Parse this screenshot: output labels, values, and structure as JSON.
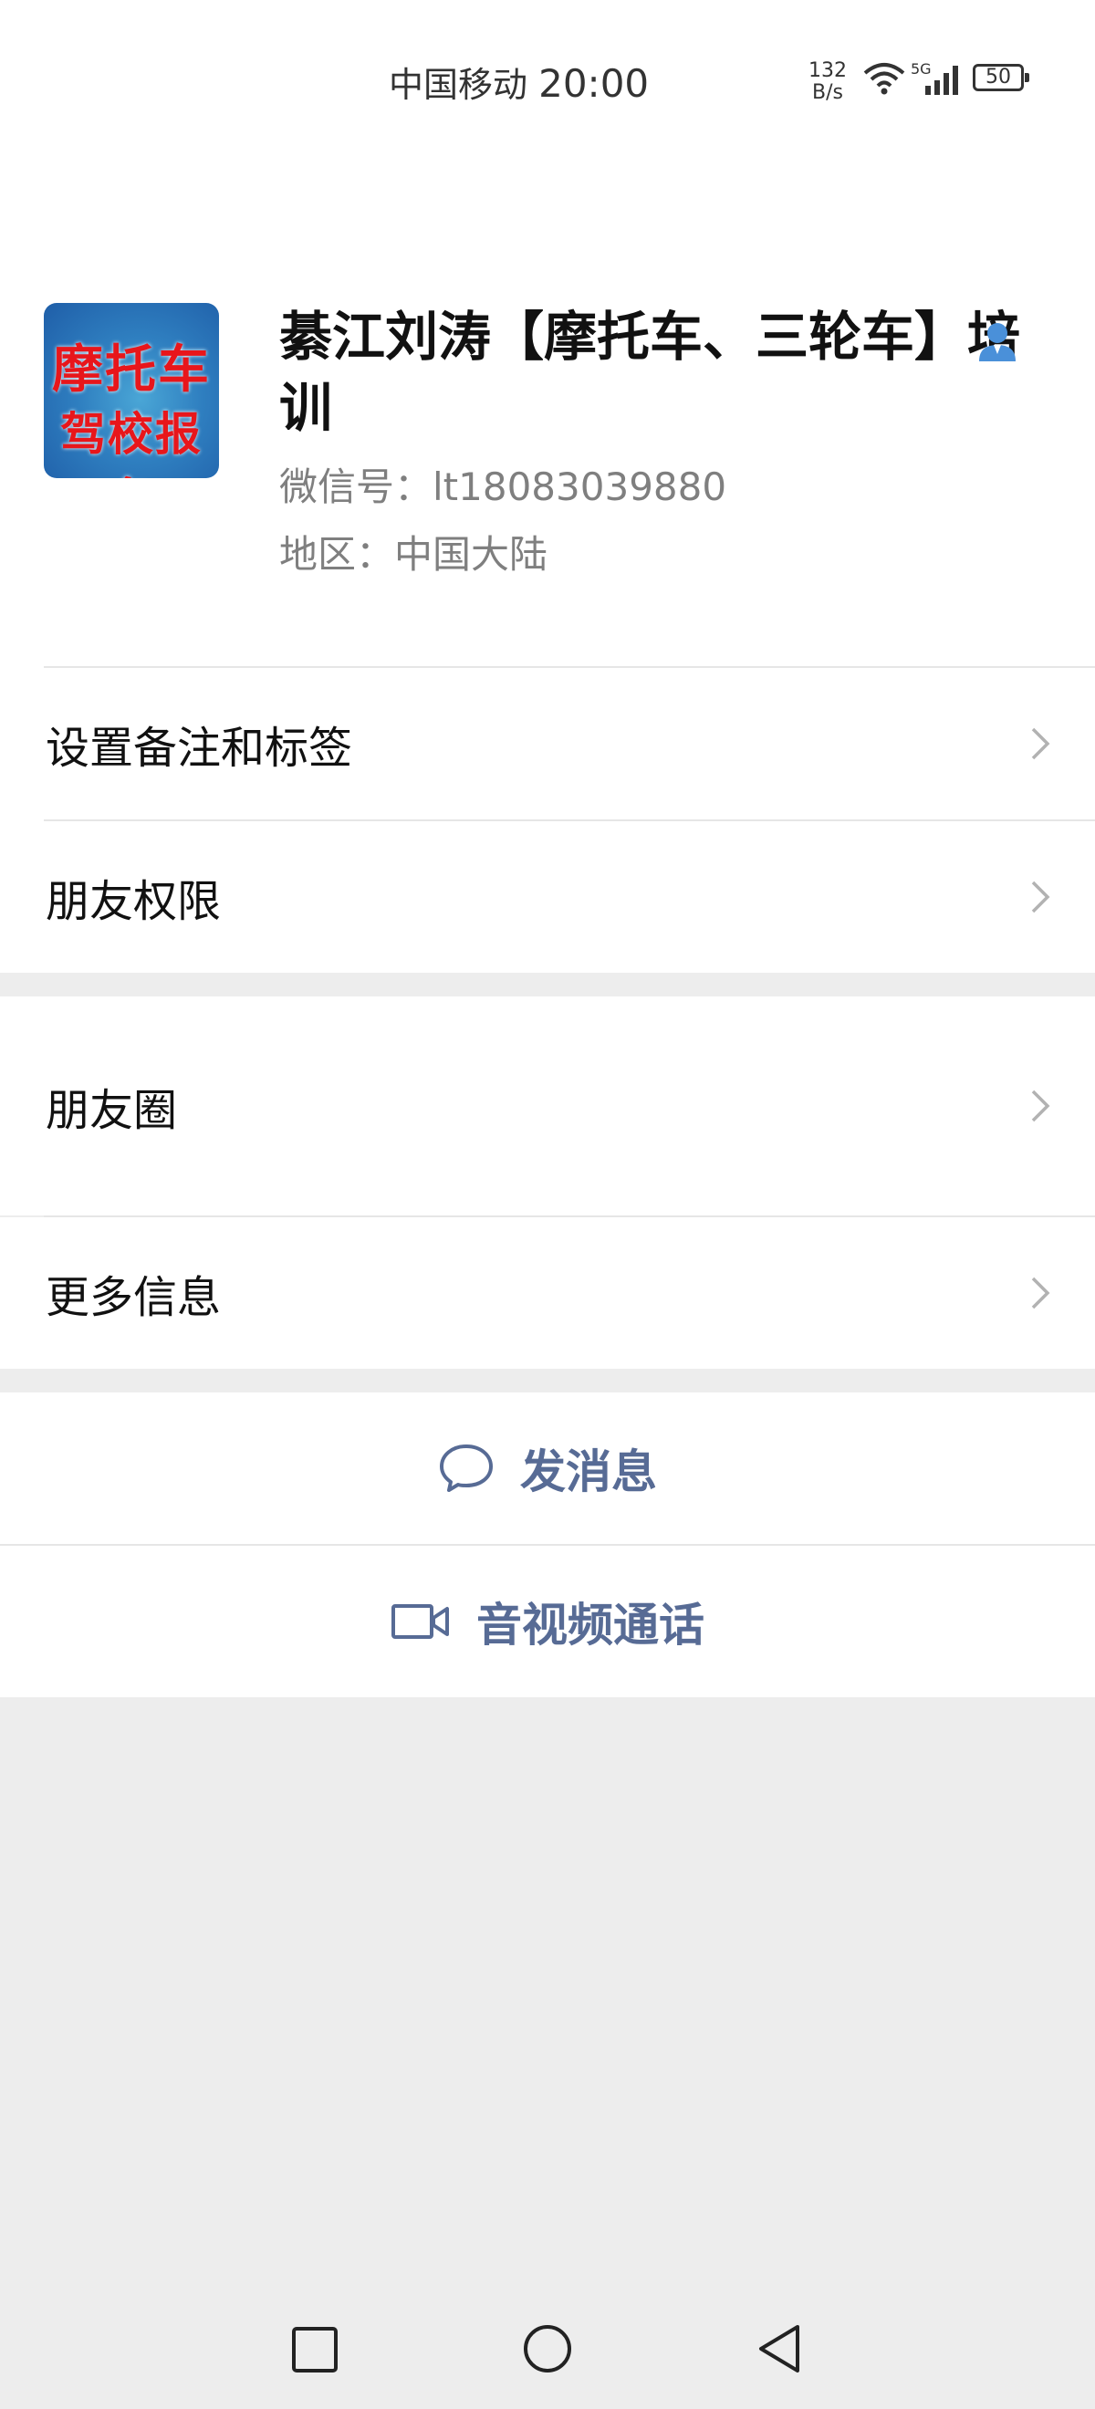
{
  "status_bar": {
    "carrier": "中国移动",
    "time": "20:00",
    "net_speed_value": "132",
    "net_speed_unit": "B/s",
    "network": "5G",
    "battery": "50"
  },
  "profile": {
    "name": "綦江刘涛【摩托车、三轮车】培训",
    "avatar_line1": "摩托车",
    "avatar_line2": "驾校报名",
    "wechat_id": "微信号：lt18083039880",
    "region": "地区：中国大陆"
  },
  "menu": {
    "remark_tags": "设置备注和标签",
    "friend_permissions": "朋友权限",
    "moments": "朋友圈",
    "more_info": "更多信息"
  },
  "actions": {
    "send_message": "发消息",
    "av_call": "音视频通话"
  },
  "colors": {
    "link": "#576b95",
    "background": "#ededed"
  }
}
